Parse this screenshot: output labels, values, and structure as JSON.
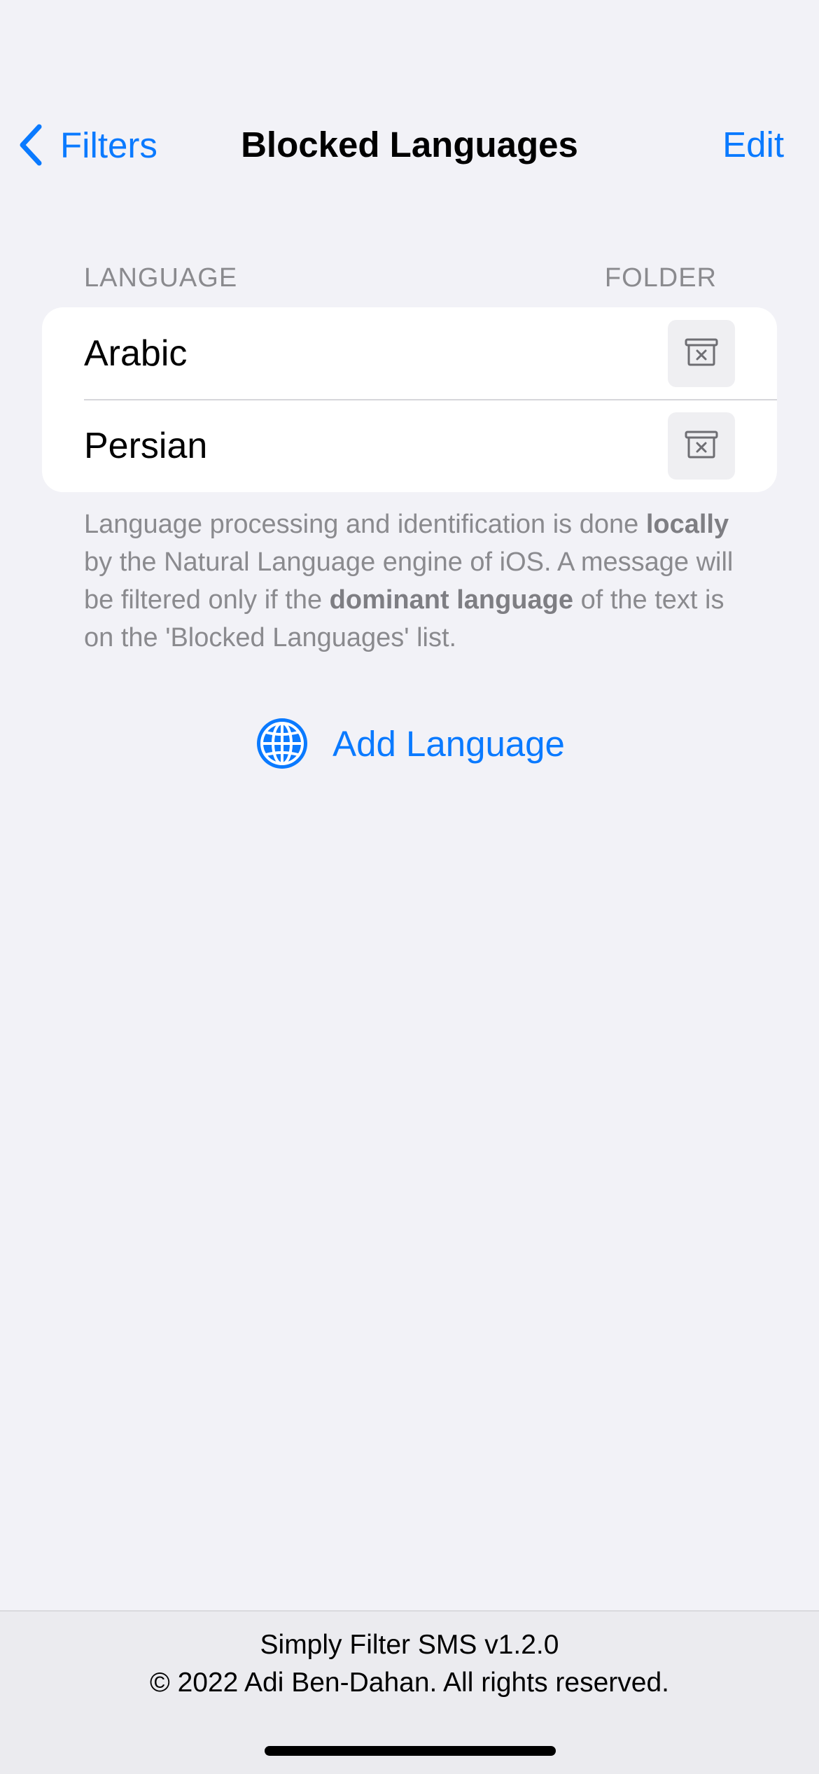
{
  "nav": {
    "back_label": "Filters",
    "title": "Blocked Languages",
    "edit_label": "Edit",
    "back_icon": "chevron-left-icon"
  },
  "section": {
    "header_left": "LANGUAGE",
    "header_right": "FOLDER",
    "rows": [
      {
        "language": "Arabic",
        "folder_icon": "junk-tray-icon"
      },
      {
        "language": "Persian",
        "folder_icon": "junk-tray-icon"
      }
    ]
  },
  "footnote": {
    "part1": "Language processing and identification is done ",
    "bold1": "locally",
    "part2": " by the Natural Language engine of iOS. A message will be filtered only if the ",
    "bold2": "dominant language",
    "part3": " of the text is on the 'Blocked Languages' list."
  },
  "add_button": {
    "label": "Add Language",
    "icon": "globe-icon"
  },
  "footer": {
    "version": "Simply Filter SMS v1.2.0",
    "copyright": "© 2022 Adi Ben-Dahan. All rights reserved."
  },
  "colors": {
    "accent": "#0a7aff",
    "background": "#f2f2f7",
    "secondary_text": "#8a8a8e"
  }
}
